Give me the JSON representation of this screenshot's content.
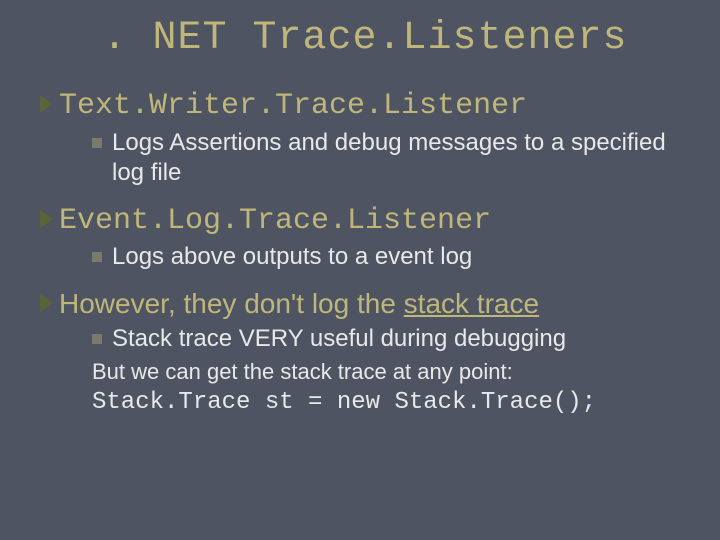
{
  "title": ". NET Trace.Listeners",
  "b1": {
    "heading": "Text.Writer.Trace.Listener",
    "sub": "Logs Assertions and debug messages to a specified log file"
  },
  "b2": {
    "heading": "Event.Log.Trace.Listener",
    "sub": "Logs above outputs to a event log"
  },
  "b3": {
    "lead": "However, ",
    "rest": "they don't log the ",
    "ul": "stack trace",
    "sub": "Stack trace VERY useful during debugging",
    "tail1": "But we can get the stack trace at any point:",
    "tail2": "Stack.Trace st = new Stack.Trace();"
  }
}
